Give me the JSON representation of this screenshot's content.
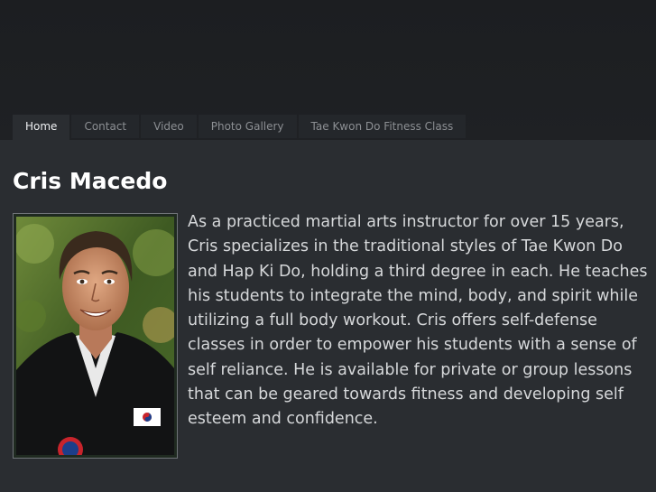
{
  "nav": {
    "items": [
      {
        "label": "Home",
        "active": true
      },
      {
        "label": "Contact",
        "active": false
      },
      {
        "label": "Video",
        "active": false
      },
      {
        "label": "Photo Gallery",
        "active": false
      },
      {
        "label": "Tae Kwon Do Fitness Class",
        "active": false
      }
    ]
  },
  "main": {
    "title": "Cris Macedo",
    "bio": "As a practiced martial arts instructor for over 15 years, Cris specializes in the traditional styles of Tae Kwon Do and Hap Ki Do, holding a third degree in each.  He teaches his students to integrate the mind, body, and spirit while utilizing a full body workout.  Cris offers self-defense classes in order to empower his students with a sense of self reliance. He is available for private or group lessons that can be geared towards fitness and developing self esteem and confidence."
  },
  "colors": {
    "header_bg": "#1c1e21",
    "content_bg": "#2a2d31",
    "nav_active_text": "#eef0f2",
    "nav_text": "#8c8f93",
    "title_text": "#ffffff",
    "body_text": "#d6d8da"
  }
}
